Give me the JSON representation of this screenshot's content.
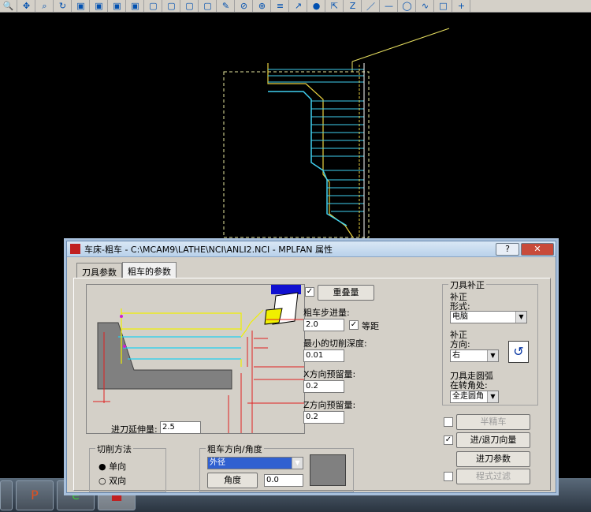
{
  "toolbar": {
    "icons": [
      "zoom-icon",
      "pan-icon",
      "zoom-window-icon",
      "rotate-icon",
      "cube-top-icon",
      "cube-front-icon",
      "cube-side-icon",
      "cube-iso-icon",
      "cube-view1-icon",
      "cube-view2-icon",
      "cube-view3-icon",
      "cube-view4-icon",
      "pencil-icon",
      "no-entry-icon",
      "point-icon",
      "layer-icon",
      "arrow-icon",
      "sphere-icon",
      "cursor-icon",
      "z-icon",
      "line-icon",
      "minus-icon",
      "ellipse-icon",
      "curve-icon",
      "square-icon",
      "plus-icon"
    ]
  },
  "dialog": {
    "title": "车床-粗车 - C:\\MCAM9\\LATHE\\NCI\\ANLI2.NCI - MPLFAN 属性",
    "help_label": "?",
    "close_label": "✕",
    "tabs": [
      {
        "label": "刀具参数"
      },
      {
        "label": "粗车的参数"
      }
    ],
    "overlap_label": "重叠量",
    "overlap_checked": "✓",
    "rough_step_label": "粗车步进量:",
    "rough_step_value": "2.0",
    "equal_dist_label": "等距",
    "equal_dist_checked": "✓",
    "min_depth_label": "最小的切削深度:",
    "min_depth_value": "0.01",
    "x_stock_label": "X方向预留量:",
    "x_stock_value": "0.2",
    "z_stock_label": "Z方向预留量:",
    "z_stock_value": "0.2",
    "entry_ext_label": "进刀延伸量:",
    "entry_ext_value": "2.5",
    "cut_method_title": "切削方法",
    "cut_method_one_way": "单向",
    "cut_method_zigzag": "双向",
    "rough_dir_title": "粗车方向/角度",
    "rough_dir_value": "外径",
    "angle_label": "角度",
    "angle_value": "0.0",
    "comp_title": "刀具补正",
    "comp_type_label_1": "补正",
    "comp_type_label_2": "形式:",
    "comp_type_value": "电脑",
    "comp_dir_label_1": "补正",
    "comp_dir_label_2": "方向:",
    "comp_dir_value": "右",
    "corner_label_1": "刀具走圆弧",
    "corner_label_2": "在转角处:",
    "corner_value": "全走圆角",
    "semi_finish_label": "半精车",
    "lead_in_out_label": "进/退刀向量",
    "lead_in_out_checked": "✓",
    "plunge_label": "进刀参数",
    "filter_label": "程式过滤"
  },
  "taskbar": {
    "items": [
      "powerpoint-icon",
      "ie-icon",
      "mastercam-icon"
    ]
  }
}
